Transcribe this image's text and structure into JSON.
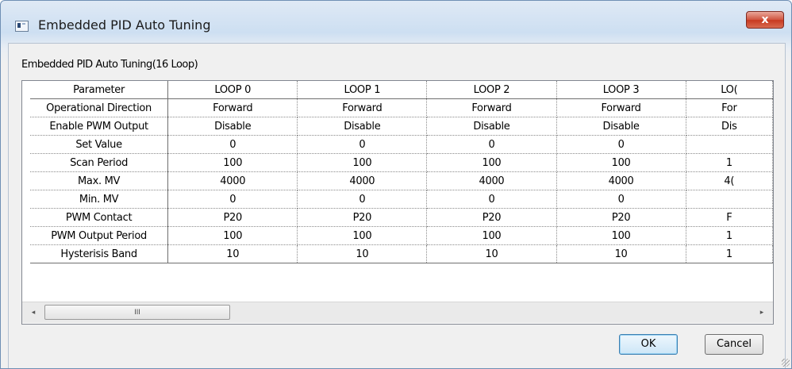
{
  "window": {
    "title": "Embedded PID Auto Tuning",
    "close_label": "x"
  },
  "group_label": "Embedded PID Auto Tuning(16 Loop)",
  "table": {
    "headers": [
      "Parameter",
      "LOOP 0",
      "LOOP 1",
      "LOOP 2",
      "LOOP 3",
      "LO("
    ],
    "rows": [
      [
        "Operational Direction",
        "Forward",
        "Forward",
        "Forward",
        "Forward",
        "For"
      ],
      [
        "Enable PWM Output",
        "Disable",
        "Disable",
        "Disable",
        "Disable",
        "Dis"
      ],
      [
        "Set Value",
        "0",
        "0",
        "0",
        "0",
        ""
      ],
      [
        "Scan Period",
        "100",
        "100",
        "100",
        "100",
        "1"
      ],
      [
        "Max. MV",
        "4000",
        "4000",
        "4000",
        "4000",
        "4("
      ],
      [
        "Min. MV",
        "0",
        "0",
        "0",
        "0",
        ""
      ],
      [
        "PWM Contact",
        "P20",
        "P20",
        "P20",
        "P20",
        "F"
      ],
      [
        "PWM Output Period",
        "100",
        "100",
        "100",
        "100",
        "1"
      ],
      [
        "Hysterisis Band",
        "10",
        "10",
        "10",
        "10",
        "1"
      ]
    ]
  },
  "scrollbar": {
    "left_arrow": "◂",
    "right_arrow": "▸",
    "thumb_grip": "III"
  },
  "buttons": {
    "ok": "OK",
    "cancel": "Cancel"
  },
  "colors": {
    "title_gradient_top": "#dfe9f5",
    "close_button": "#c7381f",
    "dialog_bg": "#f0f0f0"
  }
}
